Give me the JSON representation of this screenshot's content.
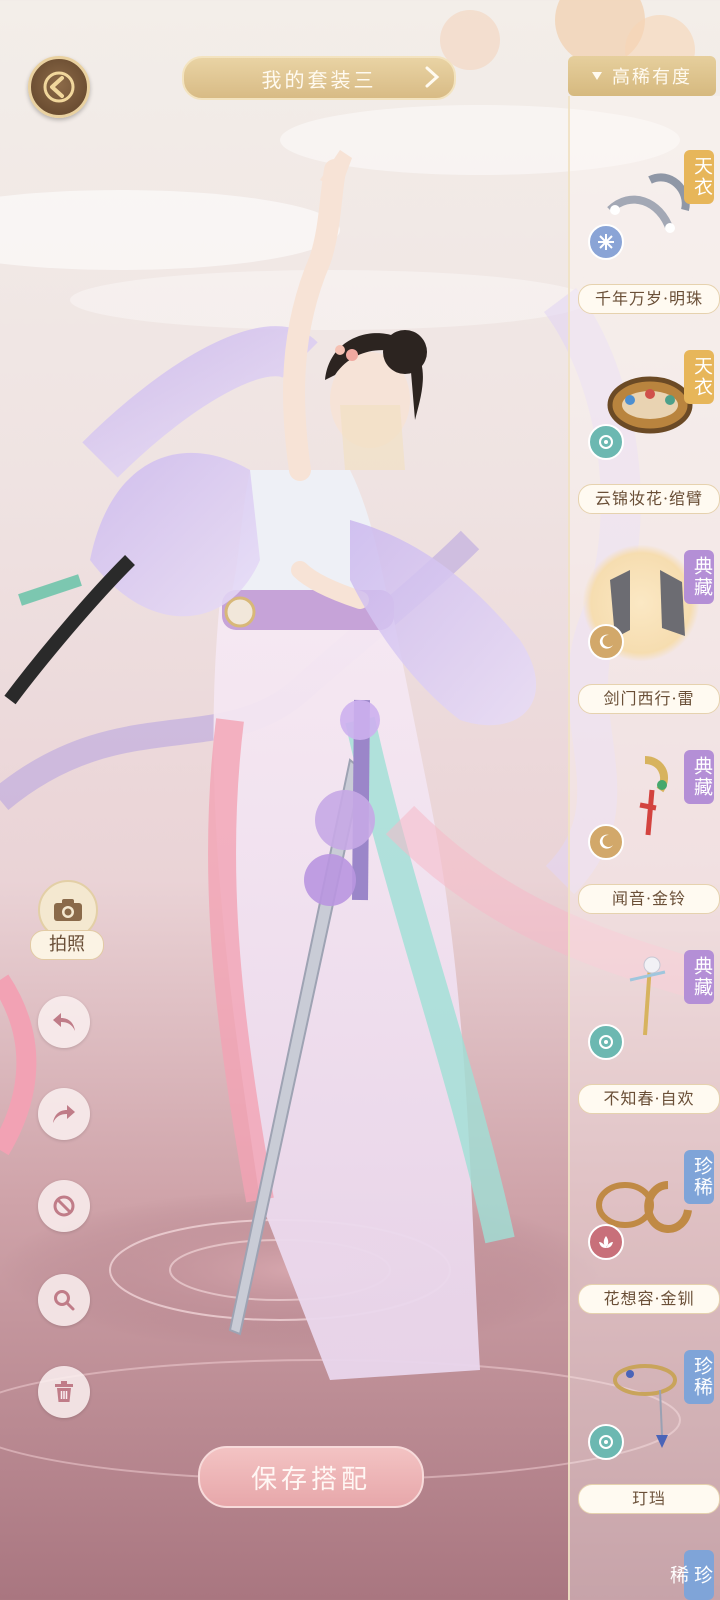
{
  "header": {
    "outfit_title": "我的套装三",
    "sort_label": "高稀有度"
  },
  "tools": {
    "photo_label": "拍照"
  },
  "save_button_label": "保存搭配",
  "items": [
    {
      "name": "千年万岁·明珠",
      "rarity": "天衣",
      "rarity_color": "#e7b65a",
      "element": "snowflake-icon",
      "element_color": "#8aa4d6"
    },
    {
      "name": "云锦妆花·绾臂",
      "rarity": "天衣",
      "rarity_color": "#e7b65a",
      "element": "swirl-icon",
      "element_color": "#6cb8b1"
    },
    {
      "name": "剑门西行·雷",
      "rarity": "典藏",
      "rarity_color": "#b48fd6",
      "element": "moon-icon",
      "element_color": "#d2a86a"
    },
    {
      "name": "闻音·金铃",
      "rarity": "典藏",
      "rarity_color": "#b48fd6",
      "element": "moon-icon",
      "element_color": "#d2a86a"
    },
    {
      "name": "不知春·自欢",
      "rarity": "典藏",
      "rarity_color": "#b48fd6",
      "element": "swirl-icon",
      "element_color": "#6cb8b1"
    },
    {
      "name": "花想容·金钏",
      "rarity": "珍稀",
      "rarity_color": "#7fa4d8",
      "element": "lotus-icon",
      "element_color": "#c8707a"
    },
    {
      "name": "玎珰",
      "rarity": "珍稀",
      "rarity_color": "#7fa4d8",
      "element": "swirl-icon",
      "element_color": "#6cb8b1"
    },
    {
      "name": "",
      "rarity": "珍稀",
      "rarity_color": "#7fa4d8",
      "element": "",
      "element_color": ""
    }
  ]
}
